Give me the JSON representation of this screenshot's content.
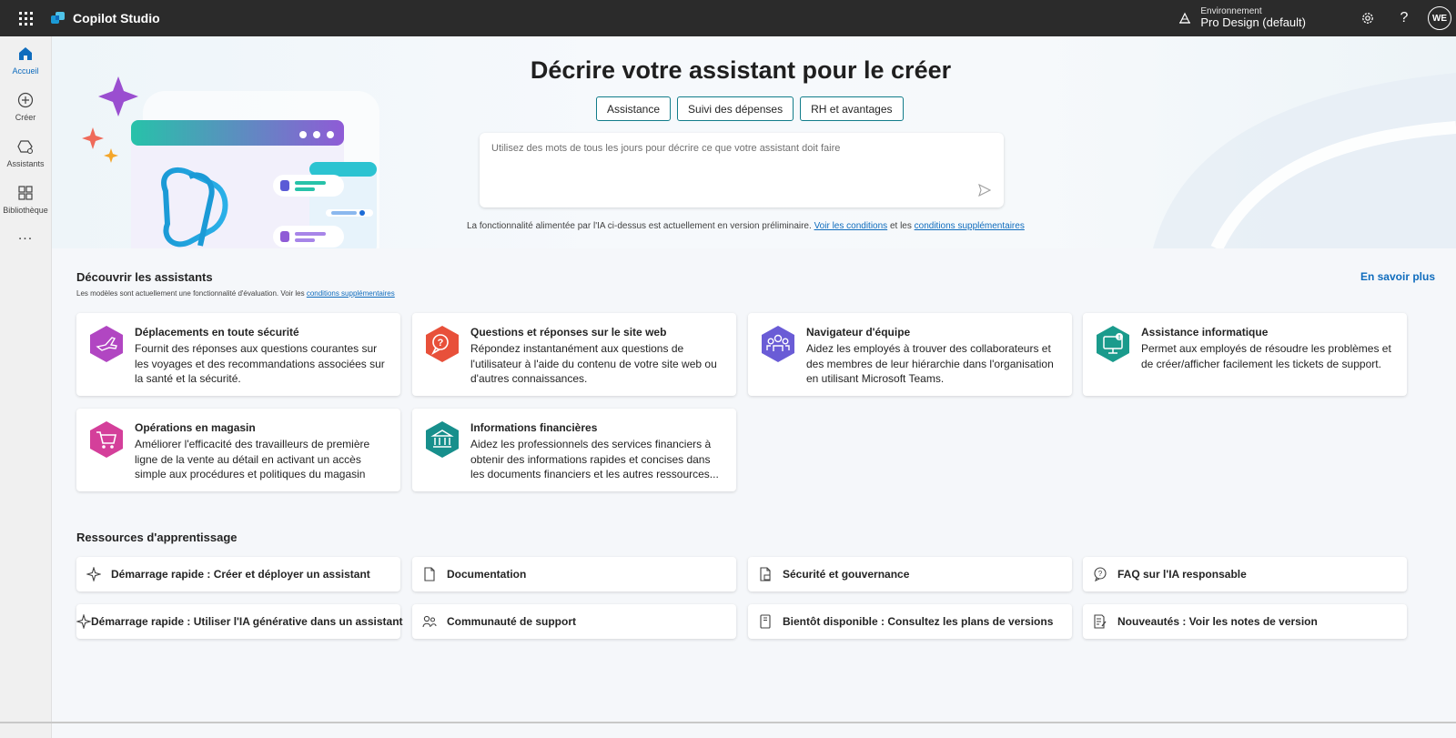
{
  "app": {
    "title": "Copilot Studio"
  },
  "environment": {
    "label": "Environnement",
    "value": "Pro Design (default)"
  },
  "user": {
    "initials": "WE"
  },
  "rail": {
    "items": [
      {
        "label": "Accueil",
        "icon": "home-icon"
      },
      {
        "label": "Créer",
        "icon": "add-circle-icon"
      },
      {
        "label": "Assistants",
        "icon": "assistants-icon"
      },
      {
        "label": "Bibliothèque",
        "icon": "library-icon"
      }
    ],
    "more": "..."
  },
  "hero": {
    "title": "Décrire votre assistant pour le créer",
    "chips": [
      "Assistance",
      "Suivi des dépenses",
      "RH et avantages"
    ],
    "placeholder": "Utilisez des mots de tous les jours pour décrire ce que votre assistant doit faire",
    "disclaimer_prefix": "La fonctionnalité alimentée par l'IA ci-dessus est actuellement en version préliminaire.",
    "disclaimer_link1": "Voir les conditions",
    "disclaimer_mid": "et les",
    "disclaimer_link2": "conditions supplémentaires"
  },
  "discover": {
    "title": "Découvrir les assistants",
    "subtitle_prefix": "Les modèles sont actuellement une fonctionnalité d'évaluation. Voir les",
    "subtitle_link": "conditions supplémentaires",
    "more": "En savoir plus",
    "cards": [
      {
        "title": "Déplacements en toute sécurité",
        "desc": "Fournit des réponses aux questions courantes sur les voyages et des recommandations associées sur la santé et la sécurité.",
        "icon": "airplane-icon",
        "color": "#b146c2"
      },
      {
        "title": "Questions et réponses sur le site web",
        "desc": "Répondez instantanément aux questions de l'utilisateur à l'aide du contenu de votre site web ou d'autres connaissances.",
        "icon": "chat-question-icon",
        "color": "#e8503a"
      },
      {
        "title": "Navigateur d'équipe",
        "desc": "Aidez les employés à trouver des collaborateurs et des membres de leur hiérarchie dans l'organisation en utilisant Microsoft Teams.",
        "icon": "people-team-icon",
        "color": "#6a5cd6"
      },
      {
        "title": "Assistance informatique",
        "desc": "Permet aux employés de résoudre les problèmes et de créer/afficher facilement les tickets de support.",
        "icon": "desktop-alert-icon",
        "color": "#1a9b8c"
      },
      {
        "title": "Opérations en magasin",
        "desc": "Améliorer l'efficacité des travailleurs de première ligne de la vente au détail en activant un accès simple aux procédures et politiques du magasin",
        "icon": "cart-icon",
        "color": "#d43f9a"
      },
      {
        "title": "Informations financières",
        "desc": "Aidez les professionnels des services financiers à obtenir des informations rapides et concises dans les documents financiers et les autres ressources...",
        "icon": "bank-icon",
        "color": "#178f8c"
      }
    ]
  },
  "resources": {
    "title": "Ressources d'apprentissage",
    "items": [
      {
        "label": "Démarrage rapide : Créer et déployer un assistant",
        "icon": "sparkle-icon"
      },
      {
        "label": "Documentation",
        "icon": "document-icon"
      },
      {
        "label": "Sécurité et gouvernance",
        "icon": "document-lock-icon"
      },
      {
        "label": "FAQ sur l'IA responsable",
        "icon": "chat-help-icon"
      },
      {
        "label": "Démarrage rapide : Utiliser l'IA générative dans un assistant",
        "icon": "sparkle-icon"
      },
      {
        "label": "Communauté de support",
        "icon": "people-community-icon"
      },
      {
        "label": "Bientôt disponible : Consultez les plans de versions",
        "icon": "book-icon"
      },
      {
        "label": "Nouveautés : Voir les notes de version",
        "icon": "notes-icon"
      }
    ]
  }
}
